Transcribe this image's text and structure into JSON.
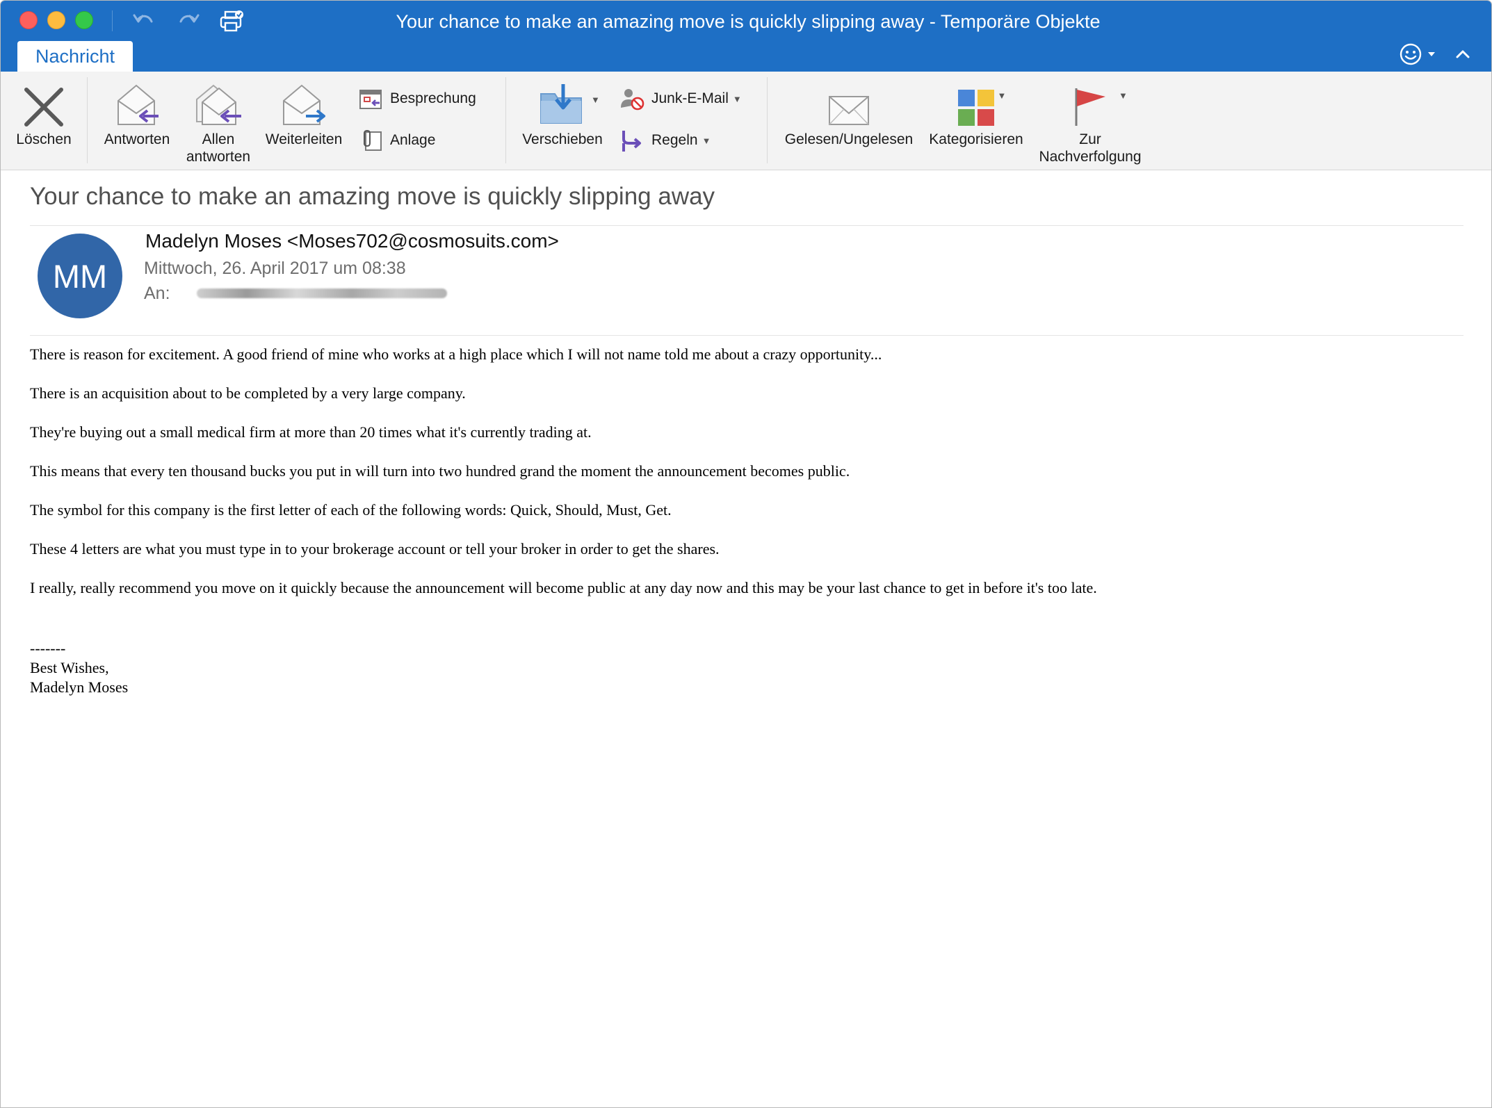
{
  "window": {
    "title": "Your chance to make an amazing move is quickly slipping away - Temporäre Objekte",
    "tab": "Nachricht"
  },
  "colors": {
    "titlebar": "#1e6fc5",
    "avatar": "#3166a8",
    "close": "#fc605c",
    "minimize": "#fdbc40",
    "maximize": "#34c84a"
  },
  "ribbon": {
    "delete": "Löschen",
    "reply": "Antworten",
    "reply_all_1": "Allen",
    "reply_all_2": "antworten",
    "forward": "Weiterleiten",
    "meeting": "Besprechung",
    "attachment": "Anlage",
    "move": "Verschieben",
    "junk": "Junk-E-Mail",
    "rules": "Regeln",
    "read_unread": "Gelesen/Ungelesen",
    "categorize": "Kategorisieren",
    "followup_1": "Zur",
    "followup_2": "Nachverfolgung"
  },
  "message": {
    "subject": "Your chance to make an amazing move is quickly slipping away",
    "initials": "MM",
    "sender": "Madelyn Moses <Moses702@cosmosuits.com>",
    "date": "Mittwoch, 26. April 2017 um 08:38",
    "to_label": "An:",
    "body": [
      "There is reason for excitement. A good friend of mine who works at a high place which I will not name told me about a crazy opportunity...",
      "There is an acquisition about to be completed by a very large company.",
      "They're buying out a small medical firm at more than 20 times what it's currently trading at.",
      "This means that every ten thousand bucks you put in will turn into two hundred grand the moment the announcement becomes public.",
      "The symbol for this company is the first letter of each of the following words: Quick, Should, Must, Get.",
      "These 4 letters are what you must type in to your brokerage account or tell your broker in order to get the shares.",
      "I really, really recommend you move on it quickly because the announcement will become public at any day now and this may be your last chance to get in before it's too late."
    ],
    "signature": {
      "dashes": "-------",
      "closing": "Best Wishes,",
      "name": "Madelyn Moses"
    }
  },
  "icons": [
    "close-window",
    "minimize-window",
    "maximize-window",
    "undo-icon",
    "redo-icon",
    "print-icon",
    "smiley-icon",
    "collapse-ribbon-icon",
    "delete-x-icon",
    "reply-icon",
    "reply-all-icon",
    "forward-icon",
    "meeting-icon",
    "attachment-icon",
    "move-folder-icon",
    "junk-icon",
    "rules-icon",
    "envelope-icon",
    "categories-icon",
    "flag-icon"
  ]
}
